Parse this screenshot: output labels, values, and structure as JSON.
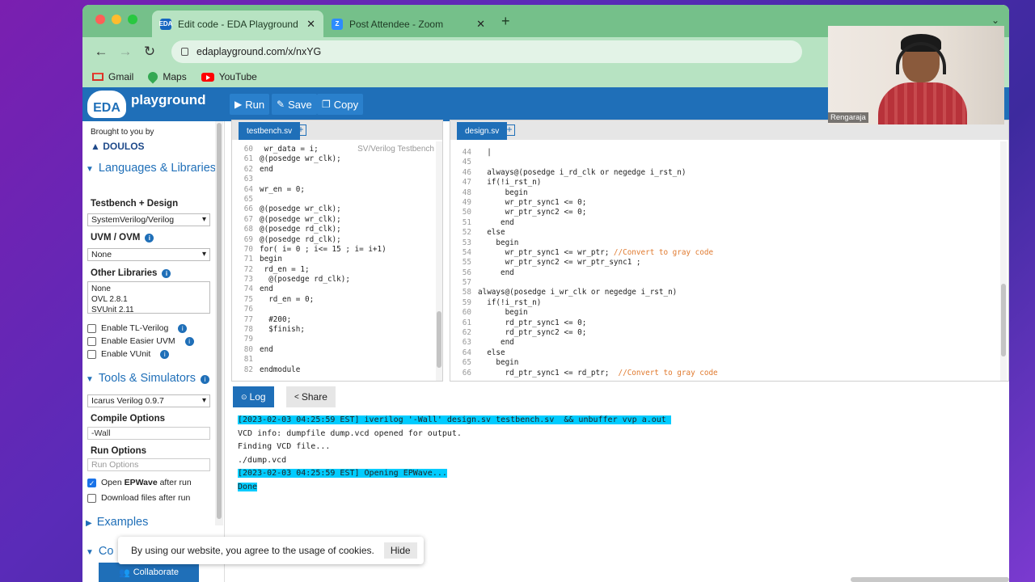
{
  "browser": {
    "tabs": [
      {
        "title": "Edit code - EDA Playground",
        "favicon": "eda-favicon",
        "active": true
      },
      {
        "title": "Post Attendee - Zoom",
        "favicon": "zoom-favicon",
        "active": false
      }
    ],
    "url": "edaplayground.com/x/nxYG",
    "bookmarks": [
      "Gmail",
      "Maps",
      "YouTube"
    ]
  },
  "header": {
    "logo_mark": "EDA",
    "logo_word": "playground",
    "run_label": "Run",
    "save_label": "Save",
    "copy_label": "Copy"
  },
  "sidebar": {
    "brought_by": "Brought to you by",
    "sponsor": "DOULOS",
    "lang_title": "Languages & Libraries",
    "tb_design_label": "Testbench + Design",
    "tb_design_value": "SystemVerilog/Verilog",
    "uvm_label": "UVM / OVM",
    "uvm_value": "None",
    "other_libs_label": "Other Libraries",
    "other_libs": [
      "None",
      "OVL 2.8.1",
      "SVUnit 2.11"
    ],
    "checks": [
      {
        "label": "Enable TL-Verilog",
        "checked": false
      },
      {
        "label": "Enable Easier UVM",
        "checked": false
      },
      {
        "label": "Enable VUnit",
        "checked": false
      }
    ],
    "tools_title": "Tools & Simulators",
    "simulator_value": "Icarus Verilog 0.9.7",
    "compile_label": "Compile Options",
    "compile_value": "-Wall",
    "run_opts_label": "Run Options",
    "run_opts_placeholder": "Run Options",
    "epwave_pre": "Open ",
    "epwave_bold": "EPWave",
    "epwave_post": " after run",
    "epwave_checked": true,
    "download_label": "Download files after run",
    "download_checked": false,
    "examples_title": "Examples",
    "collab_title": "Co",
    "collaborate_label": "Collaborate"
  },
  "testbench": {
    "tab": "testbench.sv",
    "file_tag": "SV/Verilog Testbench",
    "lines": [
      {
        "n": "60",
        "t": " wr_data = i;"
      },
      {
        "n": "61",
        "t": "@(posedge wr_clk);"
      },
      {
        "n": "62",
        "t": "end"
      },
      {
        "n": "63",
        "t": ""
      },
      {
        "n": "64",
        "t": "wr_en = 0;"
      },
      {
        "n": "65",
        "t": ""
      },
      {
        "n": "66",
        "t": "@(posedge wr_clk);"
      },
      {
        "n": "67",
        "t": "@(posedge wr_clk);"
      },
      {
        "n": "68",
        "t": "@(posedge rd_clk);"
      },
      {
        "n": "69",
        "t": "@(posedge rd_clk);"
      },
      {
        "n": "70",
        "t": "for( i= 0 ; i<= 15 ; i= i+1)"
      },
      {
        "n": "71",
        "t": "begin"
      },
      {
        "n": "72",
        "t": " rd_en = 1;"
      },
      {
        "n": "73",
        "t": "  @(posedge rd_clk);"
      },
      {
        "n": "74",
        "t": "end"
      },
      {
        "n": "75",
        "t": "  rd_en = 0;"
      },
      {
        "n": "76",
        "t": ""
      },
      {
        "n": "77",
        "t": "  #200;"
      },
      {
        "n": "78",
        "t": "  $finish;"
      },
      {
        "n": "79",
        "t": ""
      },
      {
        "n": "80",
        "t": "end"
      },
      {
        "n": "81",
        "t": ""
      },
      {
        "n": "82",
        "t": "endmodule"
      }
    ]
  },
  "design": {
    "tab": "design.sv",
    "lines": [
      {
        "n": "44",
        "t": "  |",
        "c": ""
      },
      {
        "n": "45",
        "t": "",
        "c": ""
      },
      {
        "n": "46",
        "t": "  always@(posedge i_rd_clk or negedge i_rst_n)",
        "c": ""
      },
      {
        "n": "47",
        "t": "  if(!i_rst_n)",
        "c": ""
      },
      {
        "n": "48",
        "t": "      begin",
        "c": ""
      },
      {
        "n": "49",
        "t": "      wr_ptr_sync1 <= 0;",
        "c": ""
      },
      {
        "n": "50",
        "t": "      wr_ptr_sync2 <= 0;",
        "c": ""
      },
      {
        "n": "51",
        "t": "     end",
        "c": ""
      },
      {
        "n": "52",
        "t": "  else",
        "c": ""
      },
      {
        "n": "53",
        "t": "    begin",
        "c": ""
      },
      {
        "n": "54",
        "t": "      wr_ptr_sync1 <= wr_ptr; ",
        "c": "//Convert to gray code"
      },
      {
        "n": "55",
        "t": "      wr_ptr_sync2 <= wr_ptr_sync1 ;",
        "c": ""
      },
      {
        "n": "56",
        "t": "     end",
        "c": ""
      },
      {
        "n": "57",
        "t": "",
        "c": ""
      },
      {
        "n": "58",
        "t": "always@(posedge i_wr_clk or negedge i_rst_n)",
        "c": ""
      },
      {
        "n": "59",
        "t": "  if(!i_rst_n)",
        "c": ""
      },
      {
        "n": "60",
        "t": "      begin",
        "c": ""
      },
      {
        "n": "61",
        "t": "      rd_ptr_sync1 <= 0;",
        "c": ""
      },
      {
        "n": "62",
        "t": "      rd_ptr_sync2 <= 0;",
        "c": ""
      },
      {
        "n": "63",
        "t": "     end",
        "c": ""
      },
      {
        "n": "64",
        "t": "  else",
        "c": ""
      },
      {
        "n": "65",
        "t": "    begin",
        "c": ""
      },
      {
        "n": "66",
        "t": "      rd_ptr_sync1 <= rd_ptr;  ",
        "c": "//Convert to gray code"
      }
    ]
  },
  "log": {
    "log_tab": "Log",
    "share_tab": "Share",
    "lines": [
      {
        "t": "[2023-02-03 04:25:59 EST] iverilog '-Wall' design.sv testbench.sv  && unbuffer vvp a.out ",
        "hl": true
      },
      {
        "t": "VCD info: dumpfile dump.vcd opened for output.",
        "hl": false
      },
      {
        "t": "Finding VCD file...",
        "hl": false
      },
      {
        "t": "./dump.vcd",
        "hl": false
      },
      {
        "t": "[2023-02-03 04:25:59 EST] Opening EPWave...",
        "hl": true
      },
      {
        "t": "Done",
        "hl": true
      }
    ]
  },
  "cookie": {
    "text": "By using our website, you agree to the usage of cookies.",
    "hide_label": "Hide"
  },
  "video": {
    "name": "Rengaraja"
  }
}
